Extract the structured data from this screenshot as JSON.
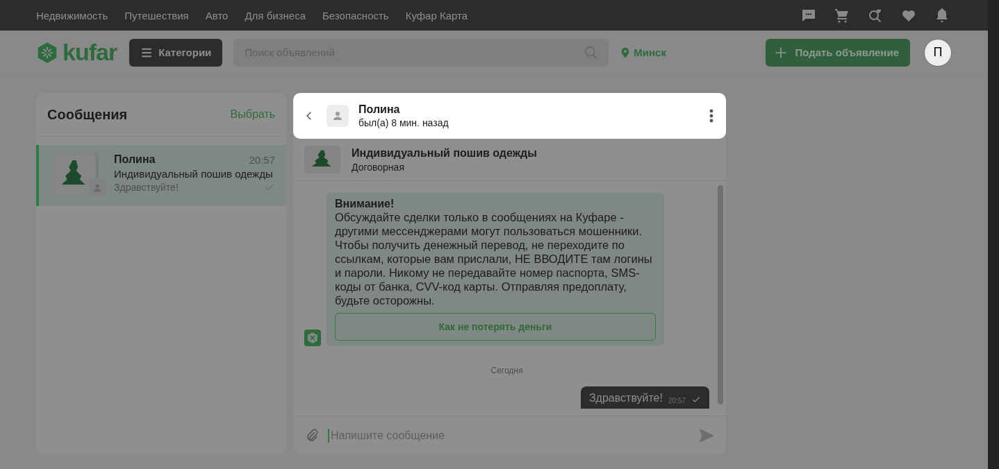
{
  "top_nav": {
    "links": [
      "Недвижимость",
      "Путешествия",
      "Авто",
      "Для бизнеса",
      "Безопасность",
      "Куфар Карта"
    ]
  },
  "header": {
    "logo": "kufar",
    "categories_button": "Категории",
    "search": {
      "placeholder": "Поиск объявлений"
    },
    "location": "Минск",
    "post_button": "Подать объявление",
    "avatar": "П"
  },
  "sidebar": {
    "title": "Сообщения",
    "action": "Выбрать",
    "conversations": [
      {
        "name": "Полина",
        "time": "20:57",
        "ad_title": "Индивидуальный пошив одежды",
        "last_message": "Здравствуйте!",
        "selected": true,
        "read": true
      }
    ]
  },
  "chat": {
    "header": {
      "name": "Полина",
      "status": "был(а) 8 мин. назад"
    },
    "ad": {
      "title": "Индивидуальный пошив одежды",
      "price": "Договорная"
    },
    "messages": [
      {
        "kind": "system",
        "title": "Внимание!",
        "text": "Обсуждайте сделки только в сообщениях на Куфаре - другими мессенджерами могут пользоваться мошенники. Чтобы получить денежный перевод, не переходите по ссылкам, которые вам прислали, НЕ ВВОДИТЕ там логины и пароли. Никому не передавайте номер паспорта, SMS-коды от банка, CVV-код карты. Отправляя предоплату, будьте осторожны.",
        "button": "Как не потерять деньги"
      },
      {
        "kind": "date",
        "text": "Сегодня"
      },
      {
        "kind": "outgoing",
        "text": "Здравствуйте!",
        "time": "20:57",
        "read": true
      }
    ],
    "composer": {
      "placeholder": "Напишите сообщение"
    }
  }
}
